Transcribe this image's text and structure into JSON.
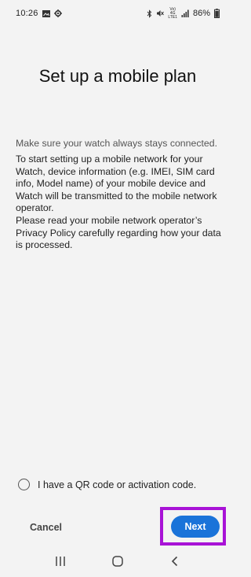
{
  "status_bar": {
    "time": "10:26",
    "battery_percent": "86%",
    "volte_top": "Vo)",
    "volte_mid": "4G",
    "volte_bot": "LTE1",
    "icons": [
      "gallery-icon",
      "settings-gear-icon",
      "bluetooth-icon",
      "mute-icon",
      "volte-indicator",
      "signal-icon",
      "battery-icon"
    ]
  },
  "page": {
    "title": "Set up a mobile plan",
    "intro": "Make sure your watch always stays connected.",
    "paragraph_1": "To start setting up a mobile network for your Watch, device information (e.g. IMEI, SIM card info, Model name) of your mobile device and Watch will be transmitted to the mobile network operator.",
    "paragraph_2": "Please read your mobile network operator’s Privacy Policy carefully regarding how your data is processed."
  },
  "qr_option": {
    "label": "I have a QR code or activation code.",
    "checked": false
  },
  "actions": {
    "cancel_label": "Cancel",
    "next_label": "Next"
  },
  "nav_bar": {
    "items": [
      "recent-apps-icon",
      "home-icon",
      "back-icon"
    ]
  },
  "colors": {
    "background": "#f3f3f3",
    "accent": "#1a73d9",
    "highlight": "#a812d6"
  }
}
